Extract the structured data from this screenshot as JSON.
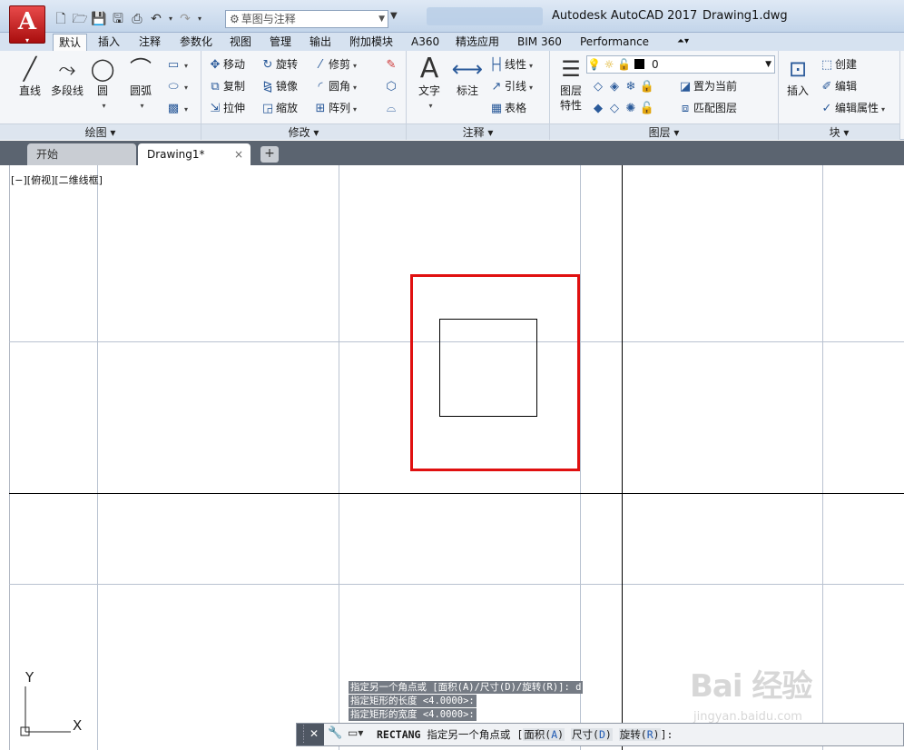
{
  "titlebar": {
    "app_title": "Autodesk AutoCAD 2017",
    "doc_title": "Drawing1.dwg",
    "app_button": "A",
    "workspace": "草图与注释"
  },
  "ribbon_tabs": [
    "默认",
    "插入",
    "注释",
    "参数化",
    "视图",
    "管理",
    "输出",
    "附加模块",
    "A360",
    "精选应用",
    "BIM 360",
    "Performance"
  ],
  "panels": {
    "draw": {
      "title": "绘图",
      "line": "直线",
      "polyline": "多段线",
      "circle": "圆",
      "arc": "圆弧"
    },
    "modify": {
      "title": "修改",
      "move": "移动",
      "rotate": "旋转",
      "trim": "修剪",
      "copy": "复制",
      "mirror": "镜像",
      "fillet": "圆角",
      "stretch": "拉伸",
      "scale": "缩放",
      "array": "阵列"
    },
    "annotation": {
      "title": "注释",
      "text": "文字",
      "dimension": "标注",
      "linear": "线性",
      "leader": "引线",
      "table": "表格"
    },
    "layers": {
      "title": "图层",
      "properties_1": "图层",
      "properties_2": "特性",
      "current_layer": "0",
      "set_current": "置为当前",
      "match_layer": "匹配图层"
    },
    "block": {
      "title": "块",
      "insert": "插入",
      "create": "创建",
      "edit": "编辑",
      "edit_attributes": "编辑属性"
    }
  },
  "file_tabs": {
    "start": "开始",
    "drawing": "Drawing1*",
    "close": "×",
    "add": "+"
  },
  "viewport_label": "[−][俯视][二维线框]",
  "command_history": [
    "指定另一个角点或 [面积(A)/尺寸(D)/旋转(R)]: d",
    "指定矩形的长度 <4.0000>:",
    "指定矩形的宽度 <4.0000>:"
  ],
  "command_line": {
    "command": "RECTANG",
    "prompt": "指定另一个角点或",
    "options": [
      {
        "label": "面积",
        "key": "A"
      },
      {
        "label": "尺寸",
        "key": "D"
      },
      {
        "label": "旋转",
        "key": "R"
      }
    ],
    "suffix": ":"
  },
  "ucs": {
    "x_label": "X",
    "y_label": "Y"
  },
  "watermark": {
    "brand": "Bai 经验",
    "url": "jingyan.baidu.com"
  },
  "colors": {
    "highlight_box": "#e01010",
    "accent_app": "#c4161c",
    "grid_line": "#b9c2d0",
    "axis_line": "#000000"
  }
}
